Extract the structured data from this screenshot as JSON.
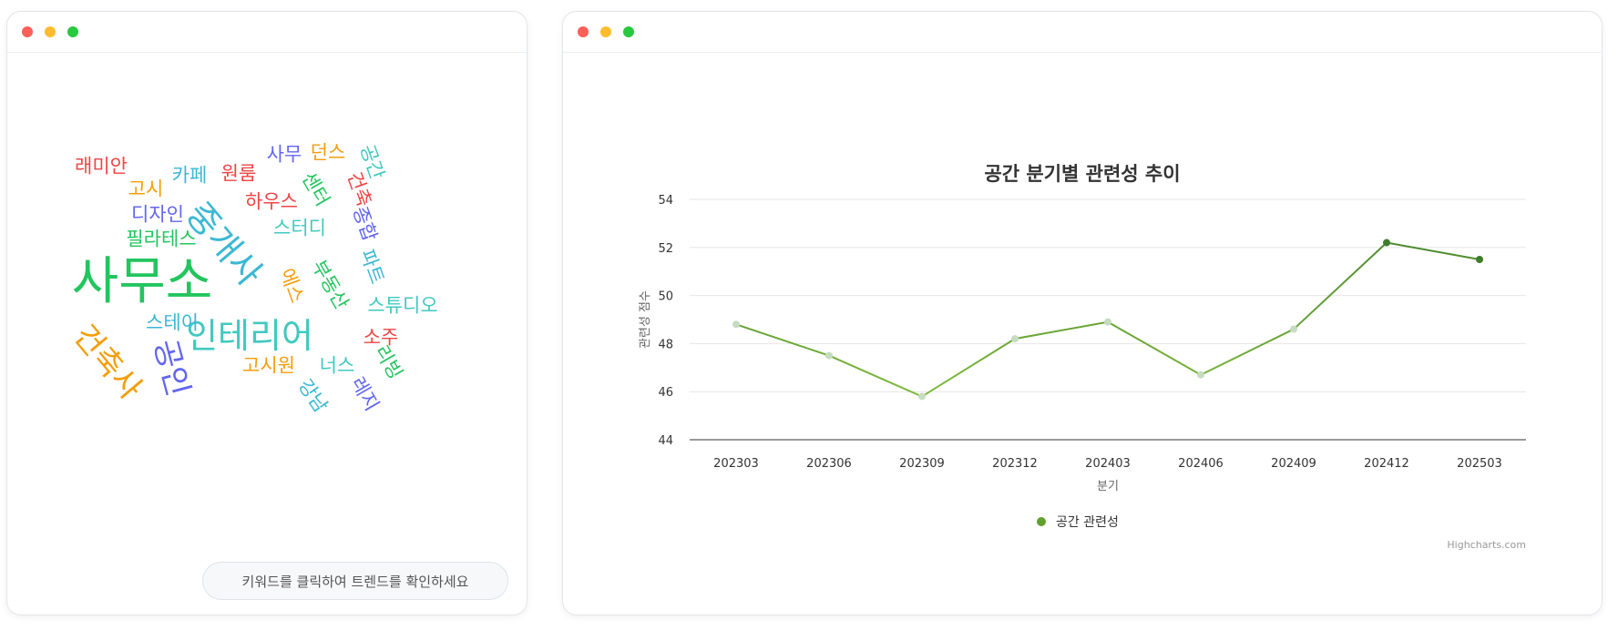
{
  "wordcloud": {
    "words": [
      {
        "text": "사무소",
        "color": "#22c55e"
      },
      {
        "text": "중개사",
        "color": "#3ab8d4"
      },
      {
        "text": "인테리어",
        "color": "#40c9c0"
      },
      {
        "text": "건축사",
        "color": "#f59e0b"
      },
      {
        "text": "공인",
        "color": "#6366f1"
      },
      {
        "text": "래미안",
        "color": "#ef4444"
      },
      {
        "text": "고시",
        "color": "#f59e0b"
      },
      {
        "text": "카페",
        "color": "#3ab8d4"
      },
      {
        "text": "원룸",
        "color": "#ef4444"
      },
      {
        "text": "사무",
        "color": "#6366f1"
      },
      {
        "text": "던스",
        "color": "#f59e0b"
      },
      {
        "text": "공간",
        "color": "#40c9c0"
      },
      {
        "text": "디자인",
        "color": "#6366f1"
      },
      {
        "text": "하우스",
        "color": "#ef4444"
      },
      {
        "text": "센터",
        "color": "#22c55e"
      },
      {
        "text": "건축",
        "color": "#ef4444"
      },
      {
        "text": "필라테스",
        "color": "#22c55e"
      },
      {
        "text": "스터디",
        "color": "#40c9c0"
      },
      {
        "text": "종합",
        "color": "#6366f1"
      },
      {
        "text": "부동산",
        "color": "#22c55e"
      },
      {
        "text": "파트",
        "color": "#3ab8d4"
      },
      {
        "text": "에스",
        "color": "#f59e0b"
      },
      {
        "text": "스튜디오",
        "color": "#40c9c0"
      },
      {
        "text": "스테이",
        "color": "#3ab8d4"
      },
      {
        "text": "소주",
        "color": "#ef4444"
      },
      {
        "text": "고시원",
        "color": "#f59e0b"
      },
      {
        "text": "너스",
        "color": "#40c9c0"
      },
      {
        "text": "리빙",
        "color": "#22c55e"
      },
      {
        "text": "강남",
        "color": "#3ab8d4"
      },
      {
        "text": "레지",
        "color": "#6366f1"
      }
    ],
    "hint": "키워드를 클릭하여 트렌드를 확인하세요"
  },
  "chart_data": {
    "type": "line",
    "title": "공간 분기별 관련성 추이",
    "xlabel": "분기",
    "ylabel": "관련성 점수",
    "categories": [
      "202303",
      "202306",
      "202309",
      "202312",
      "202403",
      "202406",
      "202409",
      "202412",
      "202503"
    ],
    "series": [
      {
        "name": "공간 관련성",
        "values": [
          48.8,
          47.5,
          45.8,
          48.2,
          48.9,
          46.7,
          48.6,
          52.2,
          51.5
        ]
      }
    ],
    "ylim": [
      44,
      54
    ],
    "yticks": [
      44,
      46,
      48,
      50,
      52,
      54
    ],
    "grid": true,
    "legend": "bottom-center",
    "credits": "Highcharts.com",
    "colors": {
      "line_dark": "#3f7d2c",
      "line_light": "#8cc63f",
      "point_light": "#c6dcc0"
    }
  }
}
